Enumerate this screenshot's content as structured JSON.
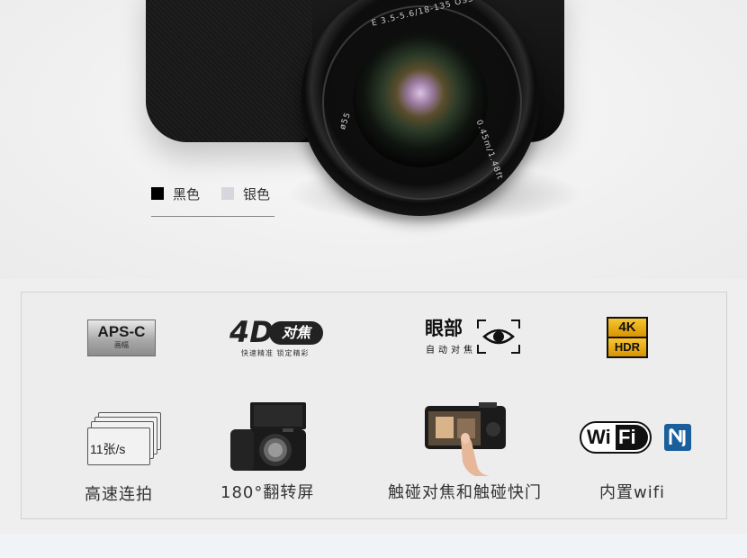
{
  "lens": {
    "top_text": "E 3.5-5.6/18-135 OSS",
    "right_text": "0.45m/1.48ft",
    "left_text": "ø55"
  },
  "colors": {
    "options": [
      {
        "label": "黑色",
        "swatch": "#000000"
      },
      {
        "label": "银色",
        "swatch": "#d6d6de"
      }
    ]
  },
  "features": {
    "apsc": {
      "title": "APS-C",
      "subtitle": "画幅"
    },
    "focus4d": {
      "big": "4D",
      "pill": "对焦",
      "subtitle": "快速精准 锁定精彩"
    },
    "eye_af": {
      "big": "眼部",
      "subtitle": "自动对焦"
    },
    "hdr": {
      "top": "4K",
      "bottom": "HDR"
    },
    "burst": {
      "badge": "11张/s",
      "caption": "高速连拍"
    },
    "tilt": {
      "caption": "180°翻转屏"
    },
    "touch": {
      "caption": "触碰对焦和触碰快门"
    },
    "wifi": {
      "logo_left": "Wi",
      "logo_right": "Fi",
      "caption": "内置wifi"
    }
  }
}
